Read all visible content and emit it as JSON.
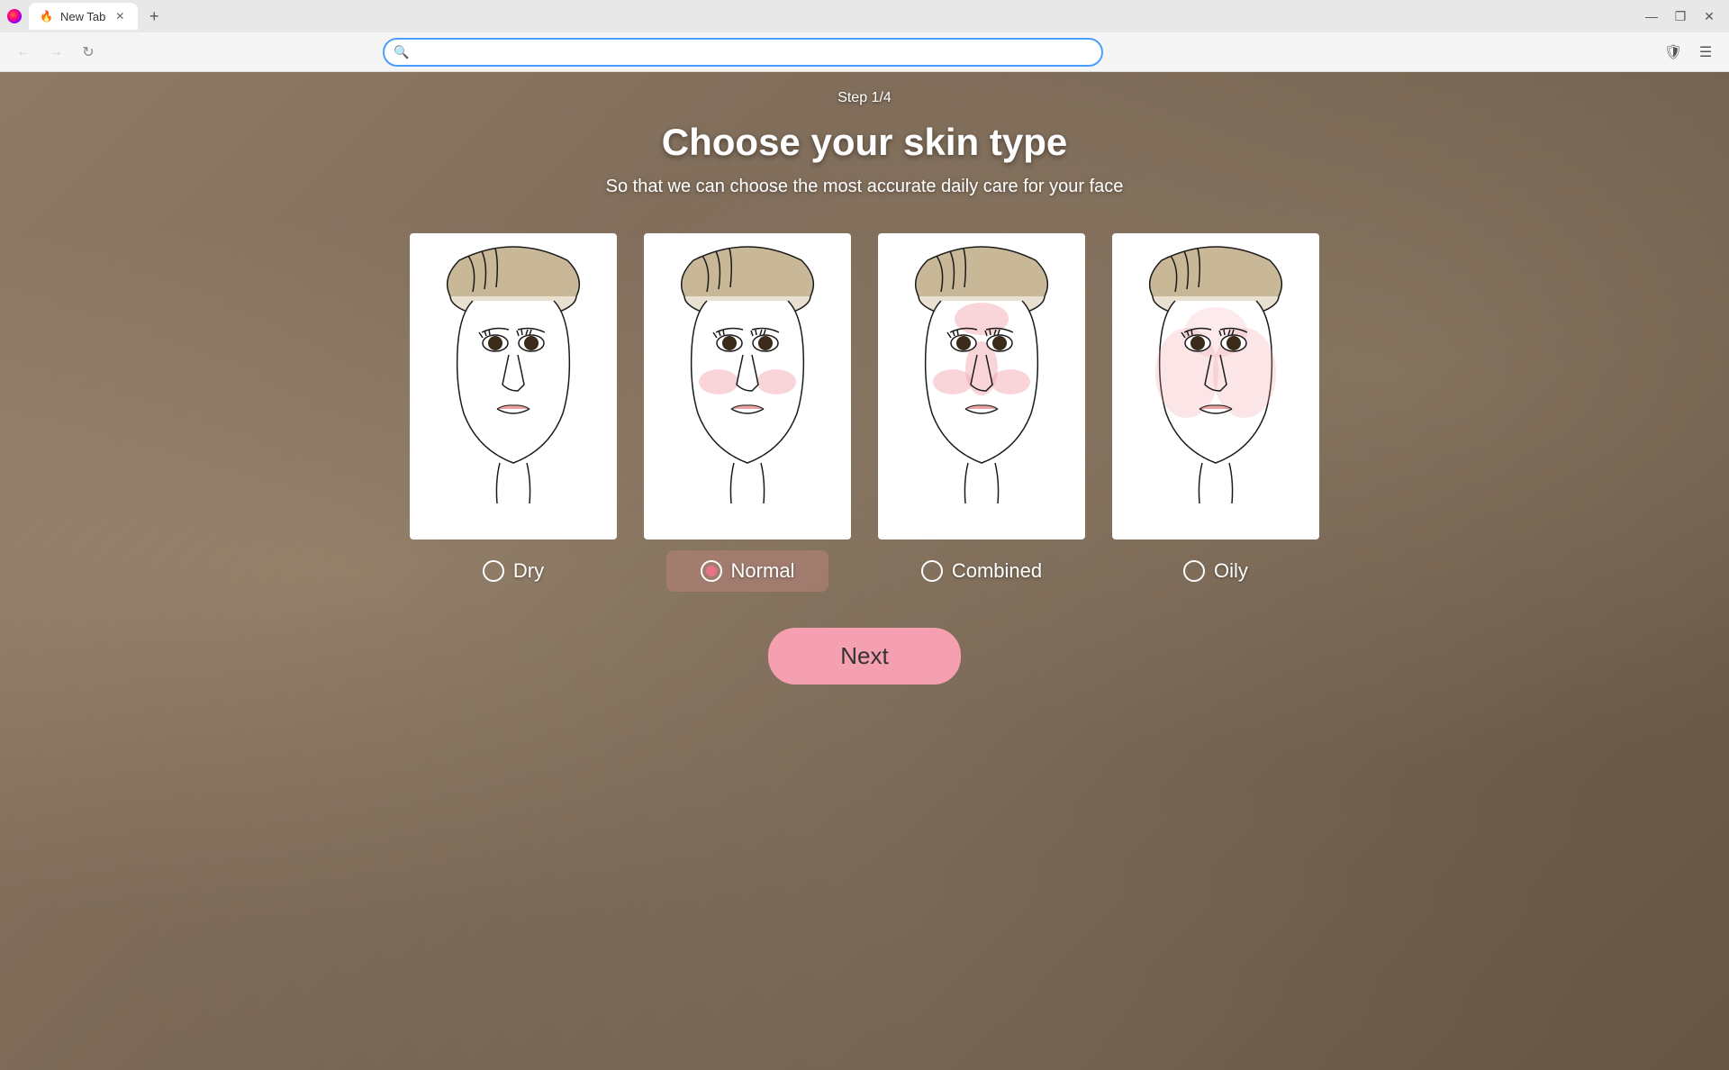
{
  "browser": {
    "tab_title": "New Tab",
    "address_placeholder": "",
    "address_value": ""
  },
  "page": {
    "step_label": "Step 1/4",
    "title": "Choose your skin type",
    "subtitle": "So that we can choose the most accurate daily care for your face",
    "next_button": "Next",
    "skin_types": [
      {
        "id": "dry",
        "label": "Dry",
        "selected": false,
        "blush_cheeks": false,
        "blush_forehead": false,
        "blush_strong": false
      },
      {
        "id": "normal",
        "label": "Normal",
        "selected": true,
        "blush_cheeks": true,
        "blush_forehead": false,
        "blush_strong": false
      },
      {
        "id": "combined",
        "label": "Combined",
        "selected": false,
        "blush_cheeks": true,
        "blush_forehead": true,
        "blush_strong": false
      },
      {
        "id": "oily",
        "label": "Oily",
        "selected": false,
        "blush_cheeks": true,
        "blush_forehead": false,
        "blush_strong": true
      }
    ]
  }
}
